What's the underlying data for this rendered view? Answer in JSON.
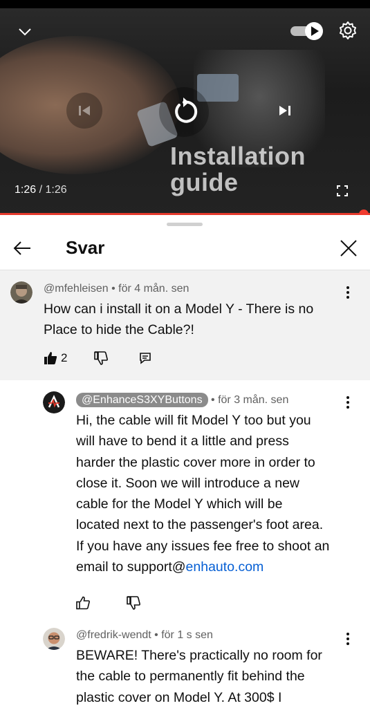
{
  "player": {
    "overlay_title": "Installation guide",
    "time_current": "1:26",
    "time_separator": " / ",
    "time_total": "1:26",
    "progress": 1.0,
    "accent_color": "#e53a2c"
  },
  "panel": {
    "title": "Svar"
  },
  "icons": {
    "collapse": "chevron-down-icon",
    "autoplay": "autoplay-toggle-icon",
    "settings": "gear-icon",
    "prev": "previous-icon",
    "replay": "replay-icon",
    "next": "next-icon",
    "fullscreen": "fullscreen-icon",
    "back": "arrow-left-icon",
    "close": "close-icon",
    "more": "more-vert-icon",
    "like": "thumb-up-icon",
    "dislike": "thumb-down-icon",
    "reply": "reply-icon"
  },
  "parent_comment": {
    "author": "@mfehleisen",
    "time": " • för 4 mån. sen",
    "line1": "How can i install it on a Model Y - There is no",
    "line2": "Place to hide the Cable?!",
    "likes": "2"
  },
  "replies": [
    {
      "author": "@EnhanceS3XYButtons",
      "time": " • för 3 mån. sen",
      "lines": [
        "Hi, the cable will fit Model Y too but you",
        "will have to bend it a little and press",
        "harder the plastic cover more in order to",
        "close it. Soon we will introduce a new",
        "cable for the Model Y which will be",
        "located next to the passenger's foot area.",
        "If you have any issues fee free to shoot an"
      ],
      "last_line_prefix": "email to support@",
      "last_line_link": "enhauto.com"
    },
    {
      "author": "@fredrik-wendt",
      "time": " • för 1 s sen",
      "lines": [
        "BEWARE! There's practically no room for",
        "the cable to permanently fit behind the",
        "plastic cover on Model Y. At 300$ I"
      ]
    }
  ]
}
